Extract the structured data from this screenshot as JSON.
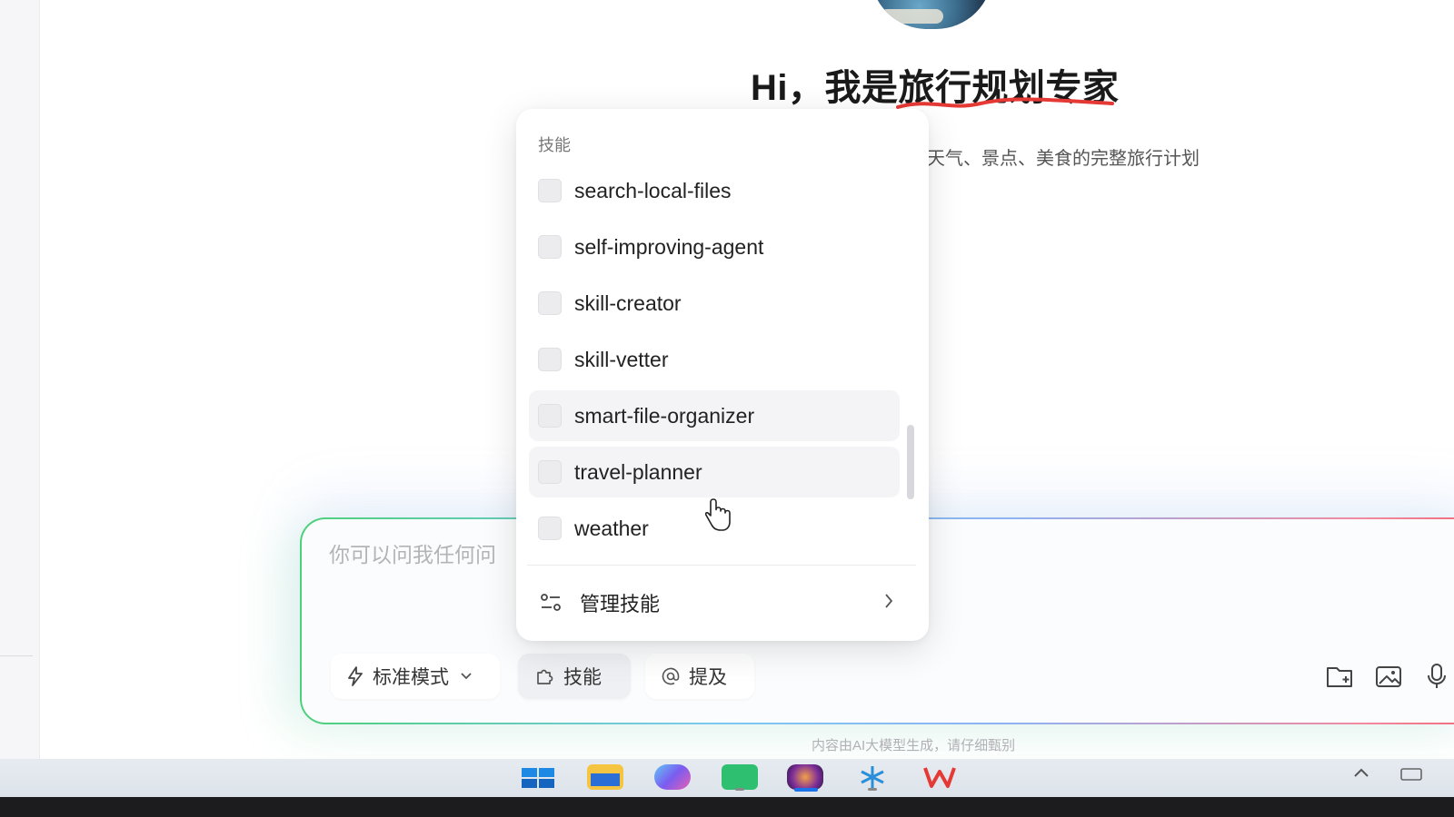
{
  "hero": {
    "greeting": "Hi，我是旅行规划专家",
    "subtitle": "天气、景点、美食的完整旅行计划"
  },
  "skills_menu": {
    "header": "技能",
    "items": [
      {
        "label": "search-local-files"
      },
      {
        "label": "self-improving-agent"
      },
      {
        "label": "skill-creator"
      },
      {
        "label": "skill-vetter"
      },
      {
        "label": "smart-file-organizer"
      },
      {
        "label": "travel-planner"
      },
      {
        "label": "weather"
      }
    ],
    "manage_label": "管理技能"
  },
  "input": {
    "placeholder": "你可以问我任何问"
  },
  "toolbar": {
    "mode_label": "标准模式",
    "skills_label": "技能",
    "mention_label": "提及"
  },
  "disclaimer": "内容由AI大模型生成，请仔细甄别",
  "colors": {
    "accent": "#1a73e8",
    "underline": "#e53935",
    "gradient_start": "#4cd07a",
    "gradient_end": "#f06a7a"
  }
}
